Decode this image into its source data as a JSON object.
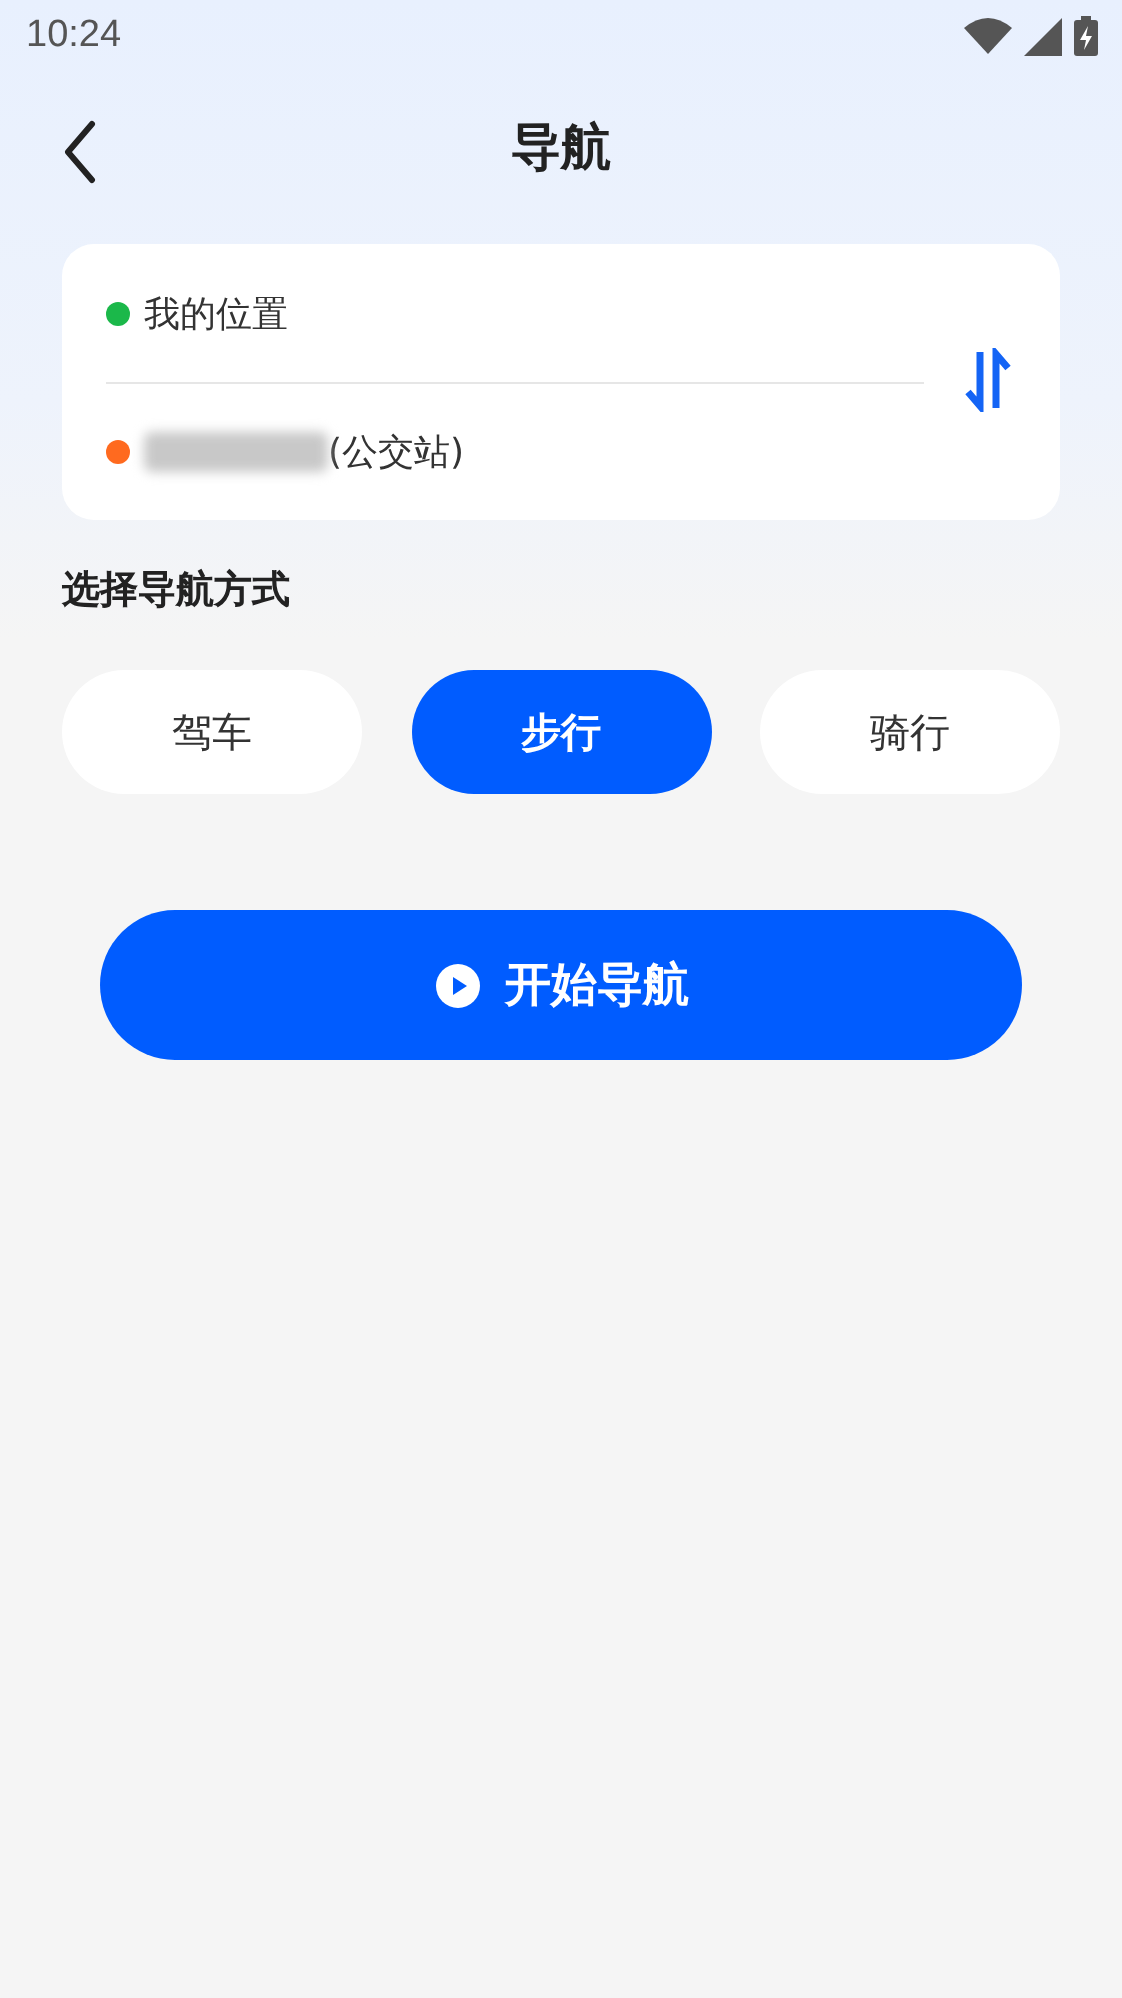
{
  "status_bar": {
    "time": "10:24"
  },
  "header": {
    "title": "导航"
  },
  "route": {
    "points": [
      {
        "label": "我的位置",
        "color": "#1bb84a",
        "redacted": false
      },
      {
        "label": "(公交站)",
        "color": "#ff6a1f",
        "redacted": true
      }
    ]
  },
  "section_title": "选择导航方式",
  "modes": [
    {
      "label": "驾车",
      "selected": false
    },
    {
      "label": "步行",
      "selected": true
    },
    {
      "label": "骑行",
      "selected": false
    }
  ],
  "start_button": {
    "label": "开始导航"
  }
}
